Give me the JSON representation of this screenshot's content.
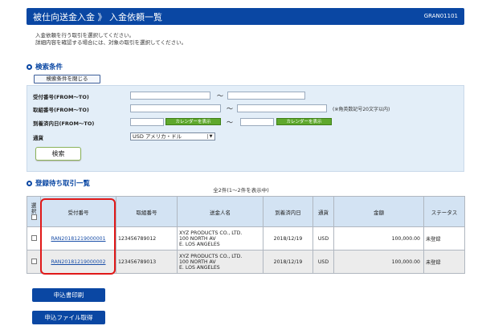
{
  "header": {
    "title": "被仕向送金入金 》 入金依頼一覧",
    "code": "GRAN01101"
  },
  "description": [
    "入金依頼を行う取引を選択してください。",
    "詳細内容を確認する場合には、対象の取引を選択してください。"
  ],
  "search": {
    "section_title": "検索条件",
    "close_button": "検索条件を閉じる",
    "receipt_label": "受付番号(FROM〜TO)",
    "transaction_label": "取組番号(FROM〜TO)",
    "arrival_label": "到着済内日(FROM〜TO)",
    "currency_label": "通貨",
    "tilde": "〜",
    "note": "(※角英数記号20文字以内)",
    "calendar_button": "カレンダーを表示",
    "currency_value": "USD アメリカ・ドル",
    "search_button": "検索"
  },
  "list": {
    "section_title": "登録待ち取引一覧",
    "count": "全2件(1〜2件を表示中)",
    "columns": {
      "select": "選択",
      "receipt": "受付番号",
      "transaction": "取組番号",
      "remitter": "送金人名",
      "arrival": "到着済内日",
      "currency": "通貨",
      "amount": "金額",
      "status": "ステータス"
    },
    "rows": [
      {
        "receipt": "RAN20181219000001",
        "transaction": "123456789012",
        "remitter": [
          "XYZ PRODUCTS CO., LTD.",
          "100 NORTH AV",
          "E. LOS ANGELES"
        ],
        "arrival": "2018/12/19",
        "currency": "USD",
        "amount": "100,000.00",
        "status": "未登録"
      },
      {
        "receipt": "RAN20181219000002",
        "transaction": "123456789013",
        "remitter": [
          "XYZ PRODUCTS CO., LTD.",
          "100 NORTH AV",
          "E. LOS ANGELES"
        ],
        "arrival": "2018/12/19",
        "currency": "USD",
        "amount": "100,000.00",
        "status": "未登録"
      }
    ]
  },
  "actions": {
    "print": "申込書印刷",
    "download": "申込ファイル取得"
  }
}
